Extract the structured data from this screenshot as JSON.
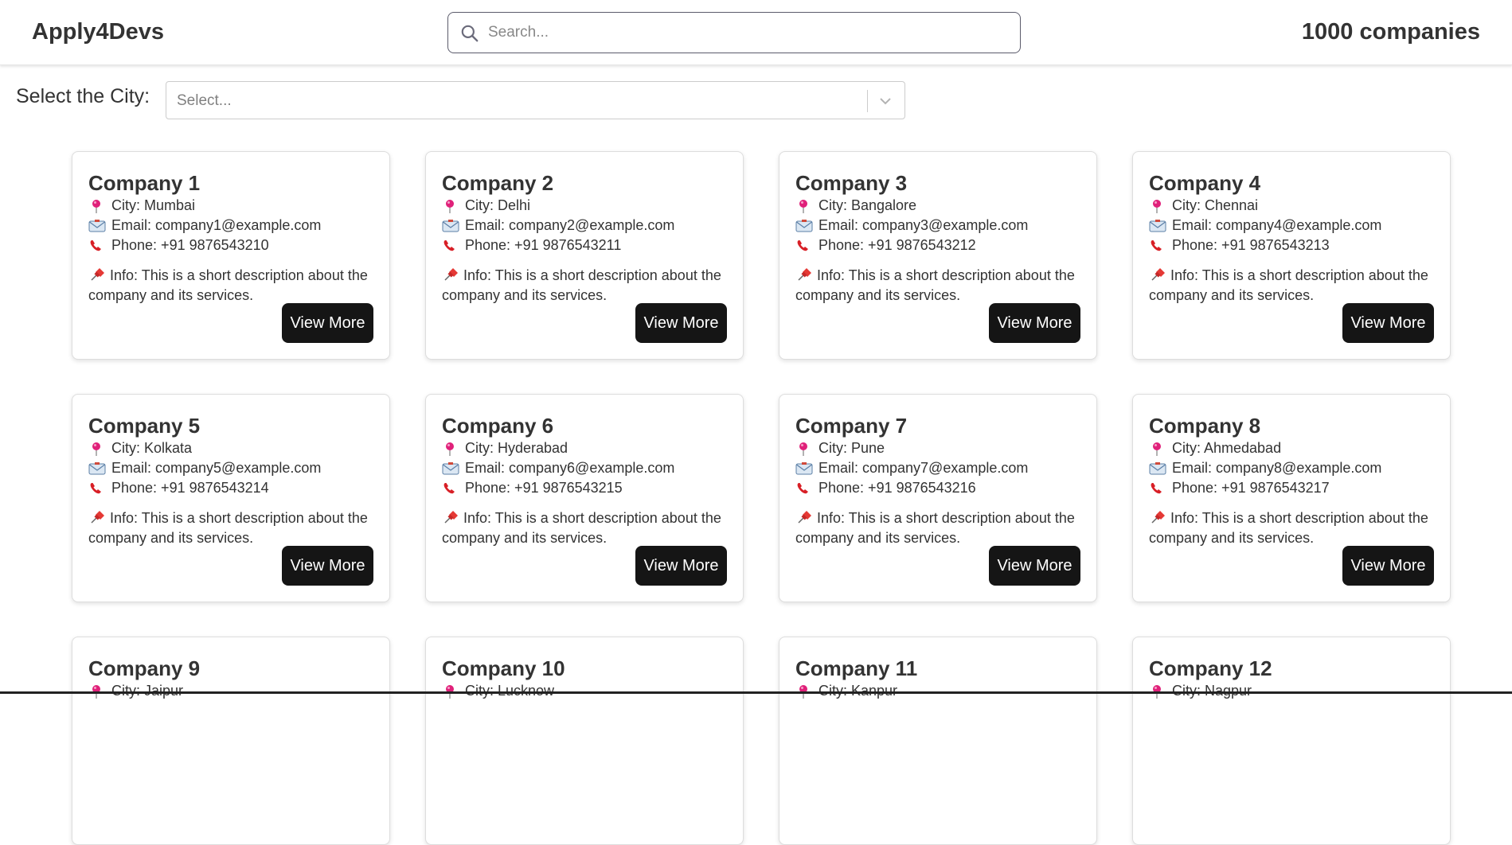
{
  "header": {
    "brand": "Apply4Devs",
    "search_placeholder": "Search...",
    "count_label": "1000 companies"
  },
  "filter": {
    "city_label": "Select the City:",
    "city_placeholder": "Select..."
  },
  "icons": {
    "search": "search-icon",
    "city": "round-pushpin-icon",
    "email": "envelope-icon",
    "phone": "telephone-receiver-icon",
    "info": "pushpin-icon",
    "dropdown": "chevron-down-icon"
  },
  "colors": {
    "button_bg": "#151515",
    "pin_head": "#e0217a",
    "phone": "#d81f26"
  },
  "cards": [
    {
      "name": "Company 1",
      "city": "City: Mumbai",
      "email": "Email: company1@example.com",
      "phone": "Phone: +91 9876543210",
      "info": "Info: This is a short description about the company and its services.",
      "button": "View More"
    },
    {
      "name": "Company 2",
      "city": "City: Delhi",
      "email": "Email: company2@example.com",
      "phone": "Phone: +91 9876543211",
      "info": "Info: This is a short description about the company and its services.",
      "button": "View More"
    },
    {
      "name": "Company 3",
      "city": "City: Bangalore",
      "email": "Email: company3@example.com",
      "phone": "Phone: +91 9876543212",
      "info": "Info: This is a short description about the company and its services.",
      "button": "View More"
    },
    {
      "name": "Company 4",
      "city": "City: Chennai",
      "email": "Email: company4@example.com",
      "phone": "Phone: +91 9876543213",
      "info": "Info: This is a short description about the company and its services.",
      "button": "View More"
    },
    {
      "name": "Company 5",
      "city": "City: Kolkata",
      "email": "Email: company5@example.com",
      "phone": "Phone: +91 9876543214",
      "info": "Info: This is a short description about the company and its services.",
      "button": "View More"
    },
    {
      "name": "Company 6",
      "city": "City: Hyderabad",
      "email": "Email: company6@example.com",
      "phone": "Phone: +91 9876543215",
      "info": "Info: This is a short description about the company and its services.",
      "button": "View More"
    },
    {
      "name": "Company 7",
      "city": "City: Pune",
      "email": "Email: company7@example.com",
      "phone": "Phone: +91 9876543216",
      "info": "Info: This is a short description about the company and its services.",
      "button": "View More"
    },
    {
      "name": "Company 8",
      "city": "City: Ahmedabad",
      "email": "Email: company8@example.com",
      "phone": "Phone: +91 9876543217",
      "info": "Info: This is a short description about the company and its services.",
      "button": "View More"
    },
    {
      "name": "Company 9",
      "city": "City: Jaipur"
    },
    {
      "name": "Company 10",
      "city": "City: Lucknow"
    },
    {
      "name": "Company 11",
      "city": "City: Kanpur"
    },
    {
      "name": "Company 12",
      "city": "City: Nagpur"
    }
  ]
}
